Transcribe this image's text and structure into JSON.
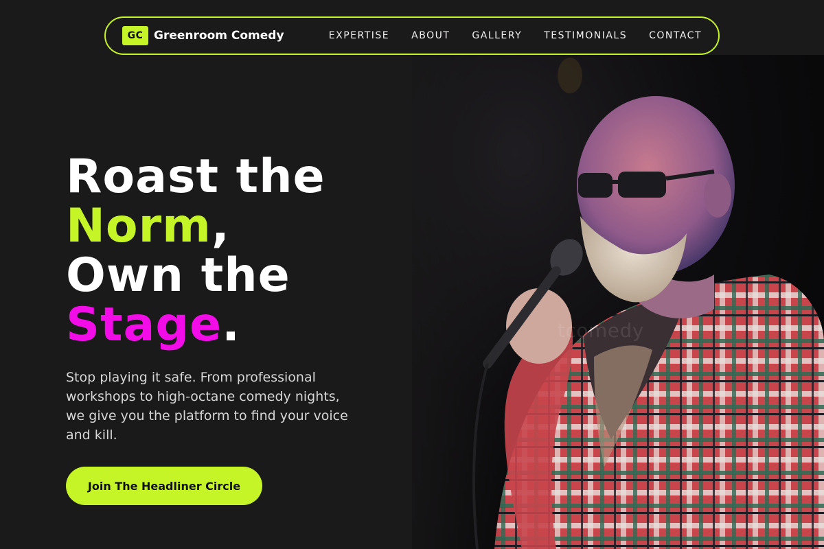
{
  "brand": {
    "badge": "GC",
    "name": "Greenroom Comedy"
  },
  "nav": {
    "items": [
      {
        "label": "EXPERTISE"
      },
      {
        "label": "ABOUT"
      },
      {
        "label": "GALLERY"
      },
      {
        "label": "TESTIMONIALS"
      },
      {
        "label": "CONTACT"
      }
    ]
  },
  "hero": {
    "line1": "Roast the",
    "line2_highlight": "Norm",
    "line2_punct": ",",
    "line3": "Own the",
    "line4_highlight": "Stage",
    "line4_punct": ".",
    "description": "Stop playing it safe. From professional workshops to high-octane comedy nights, we give you the platform to find your voice and kill.",
    "cta_label": "Join The Headliner Circle"
  },
  "photo": {
    "watermark": "tcomedy"
  },
  "colors": {
    "accent_lime": "#c6f527",
    "accent_pink": "#f20de8",
    "background": "#1b1a1b"
  }
}
